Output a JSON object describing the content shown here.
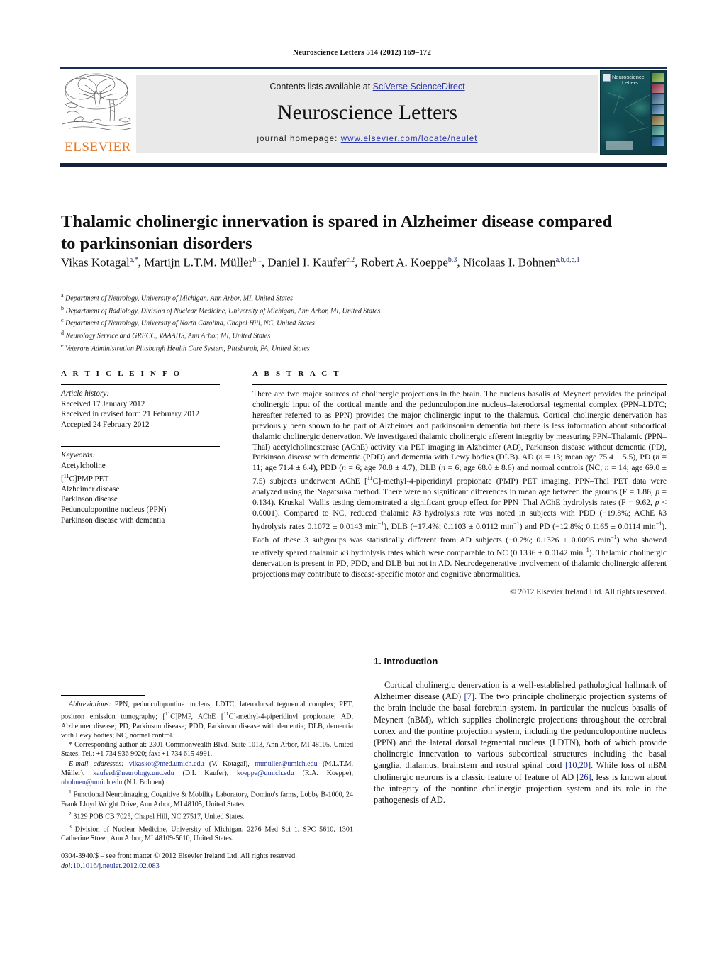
{
  "running_head": "Neuroscience Letters 514 (2012) 169–172",
  "masthead": {
    "contents_prefix": "Contents lists available at ",
    "contents_link": "SciVerse ScienceDirect",
    "journal_name": "Neuroscience Letters",
    "homepage_prefix": "journal homepage: ",
    "homepage_url": "www.elsevier.com/locate/neulet",
    "publisher_logo_text": "ELSEVIER",
    "cover_title_line1": "Neuroscience",
    "cover_title_line2": "Letters",
    "accent_orange": "#e87722",
    "link_blue": "#2a36a8",
    "rule_navy": "#16213f"
  },
  "article": {
    "title": "Thalamic cholinergic innervation is spared in Alzheimer disease compared to parkinsonian disorders",
    "authors_html": "Vikas Kotagal<sup>a,*</sup>, Martijn L.T.M. Müller<sup>b,1</sup>, Daniel I. Kaufer<sup>c,2</sup>, Robert A. Koeppe<sup>b,3</sup>, Nicolaas I. Bohnen<sup>a,b,d,e,1</sup>",
    "affiliations": [
      {
        "marker": "a",
        "text": "Department of Neurology, University of Michigan, Ann Arbor, MI, United States"
      },
      {
        "marker": "b",
        "text": "Department of Radiology, Division of Nuclear Medicine, University of Michigan, Ann Arbor, MI, United States"
      },
      {
        "marker": "c",
        "text": "Department of Neurology, University of North Carolina, Chapel Hill, NC, United States"
      },
      {
        "marker": "d",
        "text": "Neurology Service and GRECC, VAAAHS, Ann Arbor, MI, United States"
      },
      {
        "marker": "e",
        "text": "Veterans Administration Pittsburgh Health Care System, Pittsburgh, PA, United States"
      }
    ]
  },
  "article_info": {
    "heading": "A R T I C L E   I N F O",
    "history_label": "Article history:",
    "history": [
      "Received 17 January 2012",
      "Received in revised form 21 February 2012",
      "Accepted 24 February 2012"
    ],
    "keywords_label": "Keywords:",
    "keywords_html": [
      "Acetylcholine",
      "[<sup>11</sup>C]PMP PET",
      "Alzheimer disease",
      "Parkinson disease",
      "Pedunculopontine nucleus (PPN)",
      "Parkinson disease with dementia"
    ]
  },
  "abstract": {
    "heading": "A B S T R A C T",
    "body_html": "There are two major sources of cholinergic projections in the brain. The nucleus basalis of Meynert provides the principal cholinergic input of the cortical mantle and the pedunculopontine nucleus–laterodorsal tegmental complex (PPN–LDTC; hereafter referred to as PPN) provides the major cholinergic input to the thalamus. Cortical cholinergic denervation has previously been shown to be part of Alzheimer and parkinsonian dementia but there is less information about subcortical thalamic cholinergic denervation. We investigated thalamic cholinergic afferent integrity by measuring PPN–Thalamic (PPN–Thal) acetylcholinesterase (AChE) activity via PET imaging in Alzheimer (AD), Parkinson disease without dementia (PD), Parkinson disease with dementia (PDD) and dementia with Lewy bodies (DLB). AD (<span class=\"ital\">n</span> = 13; mean age 75.4 ± 5.5), PD (<span class=\"ital\">n</span> = 11; age 71.4 ± 6.4), PDD (<span class=\"ital\">n</span> = 6; age 70.8 ± 4.7), DLB (<span class=\"ital\">n</span> = 6; age 68.0 ± 8.6) and normal controls (NC; <span class=\"ital\">n</span> = 14; age 69.0 ± 7.5) subjects underwent AChE [<sup>11</sup>C]-methyl-4-piperidinyl propionate (PMP) PET imaging. PPN–Thal PET data were analyzed using the Nagatsuka method. There were no significant differences in mean age between the groups (F = 1.86, <span class=\"ital\">p</span> = 0.134). Kruskal–Wallis testing demonstrated a significant group effect for PPN–Thal AChE hydrolysis rates (F = 9.62, <span class=\"ital\">p</span> &lt; 0.0001). Compared to NC, reduced thalamic <span class=\"ital\">k</span>3 hydrolysis rate was noted in subjects with PDD (−19.8%; AChE <span class=\"ital\">k</span>3 hydrolysis rates 0.1072 ± 0.0143 min<sup>−1</sup>), DLB (−17.4%; 0.1103 ± 0.0112 min<sup>−1</sup>) and PD (−12.8%; 0.1165 ± 0.0114 min<sup>−1</sup>). Each of these 3 subgroups was statistically different from AD subjects (−0.7%; 0.1326 ± 0.0095 min<sup>−1</sup>) who showed relatively spared thalamic <span class=\"ital\">k</span>3 hydrolysis rates which were comparable to NC (0.1336 ± 0.0142 min<sup>−1</sup>). Thalamic cholinergic denervation is present in PD, PDD, and DLB but not in AD. Neurodegenerative involvement of thalamic cholinergic afferent projections may contribute to disease-specific motor and cognitive abnormalities.",
    "copyright": "© 2012 Elsevier Ireland Ltd. All rights reserved."
  },
  "footnotes": {
    "abbreviations_html": "<span class=\"ital\">Abbreviations:</span> PPN, pedunculopontine nucleus; LDTC, laterodorsal tegmental complex; PET, positron emission tomography; [<sup>11</sup>C]PMP, AChE [<sup>11</sup>C]-methyl-4-piperidinyl propionate; AD, Alzheimer disease; PD, Parkinson disease; PDD, Parkinson disease with dementia; DLB, dementia with Lewy bodies; NC, normal control.",
    "corresponding_html": "* Corresponding author at: 2301 Commonwealth Blvd, Suite 1013, Ann Arbor, MI 48105, United States. Tel.: +1 734 936 9020; fax: +1 734 615 4991.",
    "emails_html": "<span class=\"ital\">E-mail addresses:</span> <span class=\"mail\">vikaskot@med.umich.edu</span> (V. Kotagal), <span class=\"mail\">mtmuller@umich.edu</span> (M.L.T.M. Müller), <span class=\"mail\">kauferd@neurology.unc.edu</span> (D.I. Kaufer), <span class=\"mail\">koeppe@umich.edu</span> (R.A. Koeppe), <span class=\"mail\">nbohnen@umich.edu</span> (N.I. Bohnen).",
    "numbered": [
      "<sup>1</sup> Functional Neuroimaging, Cognitive &amp; Mobility Laboratory, Domino's farms, Lobby B-1000, 24 Frank Lloyd Wright Drive, Ann Arbor, MI 48105, United States.",
      "<sup>2</sup> 3129 POB CB 7025, Chapel Hill, NC 27517, United States.",
      "<sup>3</sup> Division of Nuclear Medicine, University of Michigan, 2276 Med Sci 1, SPC 5610, 1301 Catherine Street, Ann Arbor, MI 48109-5610, United States."
    ],
    "issn_line": "0304-3940/$ – see front matter © 2012 Elsevier Ireland Ltd. All rights reserved.",
    "doi_label": "doi:",
    "doi_value": "10.1016/j.neulet.2012.02.083"
  },
  "introduction": {
    "heading": "1. Introduction",
    "body_html": "Cortical cholinergic denervation is a well-established pathological hallmark of Alzheimer disease (AD) <span class=\"ref\">[7]</span>. The two principle cholinergic projection systems of the brain include the basal forebrain system, in particular the nucleus basalis of Meynert (nBM), which supplies cholinergic projections throughout the cerebral cortex and the pontine projection system, including the pedunculopontine nucleus (PPN) and the lateral dorsal tegmental nucleus (LDTN), both of which provide cholinergic innervation to various subcortical structures including the basal ganglia, thalamus, brainstem and rostral spinal cord <span class=\"ref\">[10,20]</span>. While loss of nBM cholinergic neurons is a classic feature of feature of AD <span class=\"ref\">[26]</span>, less is known about the integrity of the pontine cholinergic projection system and its role in the pathogenesis of AD."
  }
}
